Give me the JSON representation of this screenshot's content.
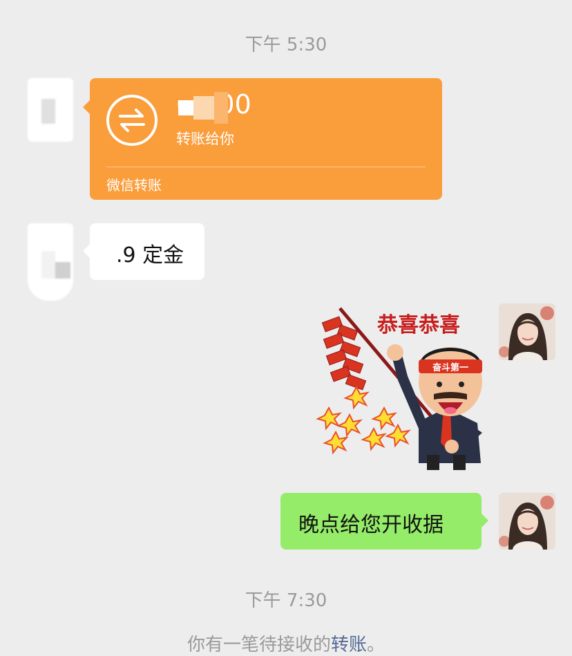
{
  "timestamps": [
    "下午 5:30",
    "下午 7:30"
  ],
  "transfer": {
    "amount": "00.00",
    "subtitle": "转账给你",
    "footer": "微信转账",
    "color": "#fa9d3b"
  },
  "messages": {
    "deposit_text": ".9 定金",
    "reply_text": "晚点给您开收据"
  },
  "sticker": {
    "caption": "恭喜恭喜",
    "headband": "奋斗第一"
  },
  "bottom_note": {
    "text": "你有一笔待接收的",
    "link": "转账",
    "tail": "。"
  },
  "colors": {
    "background": "#ededed",
    "bubble_green": "#95ec69",
    "link": "#576b95"
  }
}
